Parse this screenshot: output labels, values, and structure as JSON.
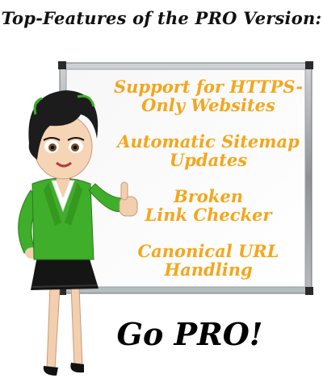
{
  "header": {
    "title": "Top-Features of the PRO Version:"
  },
  "features": [
    {
      "lines": [
        "Support for HTTPS-",
        "Only Websites"
      ]
    },
    {
      "lines": [
        "Automatic Sitemap",
        "Updates"
      ]
    },
    {
      "lines": [
        "Broken",
        "Link Checker"
      ]
    },
    {
      "lines": [
        "Canonical URL",
        "Handling"
      ]
    }
  ],
  "cta": {
    "label": "Go PRO!"
  },
  "colors": {
    "feature_text": "#f4a61c",
    "jacket": "#3fae2a",
    "hair": "#1c1c1c"
  }
}
